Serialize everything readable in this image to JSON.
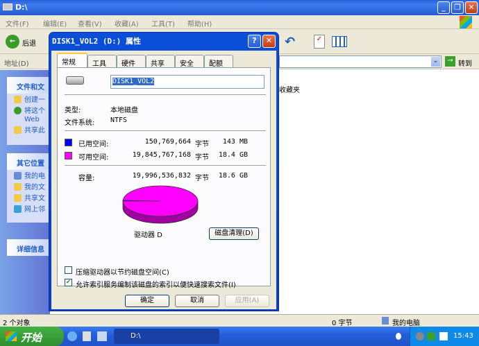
{
  "explorer": {
    "title": "D:\\",
    "menu": [
      "文件(F)",
      "编辑(E)",
      "查看(V)",
      "收藏(A)",
      "工具(T)",
      "帮助(H)"
    ],
    "back_label": "后退",
    "address_label": "地址(D)",
    "go_label": "转到",
    "favorites_text": "收藏夹",
    "left_tasks": {
      "title": "文件和文",
      "items": [
        "创建一",
        "将这个",
        "Web",
        "共享此"
      ]
    },
    "left_other": {
      "title": "其它位置",
      "items": [
        "我的电",
        "我的文",
        "共享文",
        "网上邻"
      ]
    },
    "left_details": {
      "title": "详细信息"
    },
    "status": {
      "left": "2 个对象",
      "size": "0 字节",
      "computer": "我的电脑"
    }
  },
  "taskbar": {
    "start": "开始",
    "task": "D:\\",
    "clock": "15:43"
  },
  "dialog": {
    "title": "DISK1_VOL2 (D:) 属性",
    "tabs": [
      "常规",
      "工具",
      "硬件",
      "共享",
      "安全",
      "配额"
    ],
    "name_value": "DISK1_VOL2",
    "type_label": "类型:",
    "type_value": "本地磁盘",
    "fs_label": "文件系统:",
    "fs_value": "NTFS",
    "used_label": "已用空间:",
    "used_bytes": "150,769,664",
    "used_unit": "字节",
    "used_size": "143 MB",
    "free_label": "可用空间:",
    "free_bytes": "19,845,767,168",
    "free_unit": "字节",
    "free_size": "18.4 GB",
    "cap_label": "容量:",
    "cap_bytes": "19,996,536,832",
    "cap_unit": "字节",
    "cap_size": "18.6 GB",
    "drive_label": "驱动器 D",
    "cleanup": "磁盘清理(D)",
    "compress_label": "压缩驱动器以节约磁盘空间(C)",
    "compress_checked": false,
    "index_label": "允许索引服务编制该磁盘的索引以便快速搜索文件(I)",
    "index_checked": true,
    "ok": "确定",
    "cancel": "取消",
    "apply": "应用(A)",
    "colors": {
      "used": "#0000ff",
      "free": "#ff00ff"
    },
    "used_fraction": 0.0075
  }
}
